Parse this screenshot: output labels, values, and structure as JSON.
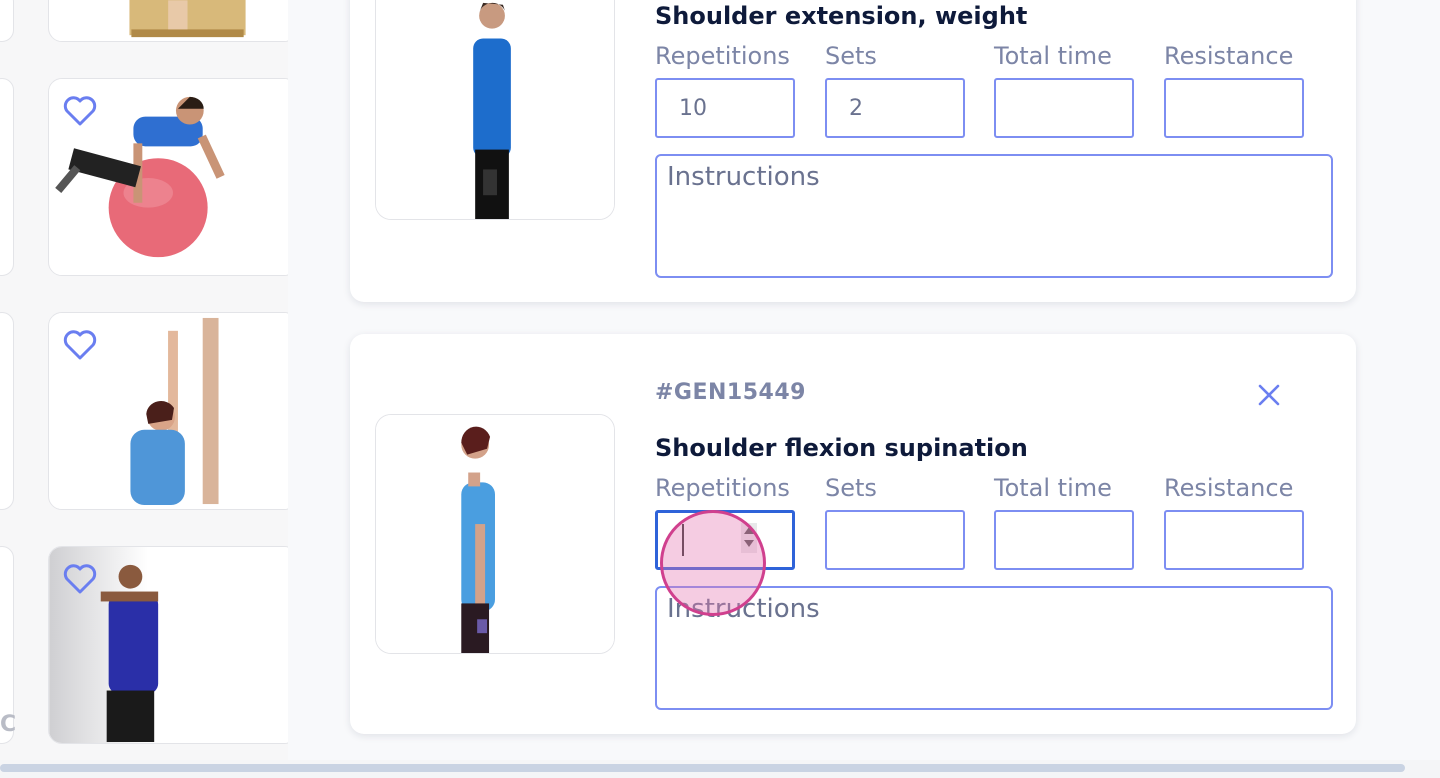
{
  "library": {
    "cards": [
      {
        "name": "bed-exercise"
      },
      {
        "name": "ball-prone-exercise"
      },
      {
        "name": "wall-arm-raise-exercise"
      },
      {
        "name": "wall-shoulder-stretch-exercise"
      }
    ],
    "fragment_letter": "C"
  },
  "exercises": [
    {
      "code": "",
      "title": "Shoulder extension, weight",
      "labels": {
        "repetitions": "Repetitions",
        "sets": "Sets",
        "total_time": "Total time",
        "resistance": "Resistance"
      },
      "values": {
        "repetitions": "10",
        "sets": "2",
        "total_time": "",
        "resistance": ""
      },
      "instructions_placeholder": "Instructions"
    },
    {
      "code": "#GEN15449",
      "title": "Shoulder flexion supination",
      "labels": {
        "repetitions": "Repetitions",
        "sets": "Sets",
        "total_time": "Total time",
        "resistance": "Resistance"
      },
      "values": {
        "repetitions": "",
        "sets": "",
        "total_time": "",
        "resistance": ""
      },
      "instructions_placeholder": "Instructions"
    }
  ],
  "colors": {
    "accent": "#7d8ef2",
    "focus": "#2f63d9",
    "label": "#7c85a6",
    "title": "#0e1a3a"
  },
  "icons": {
    "favorite": "heart-outline-icon",
    "remove": "close-icon"
  }
}
